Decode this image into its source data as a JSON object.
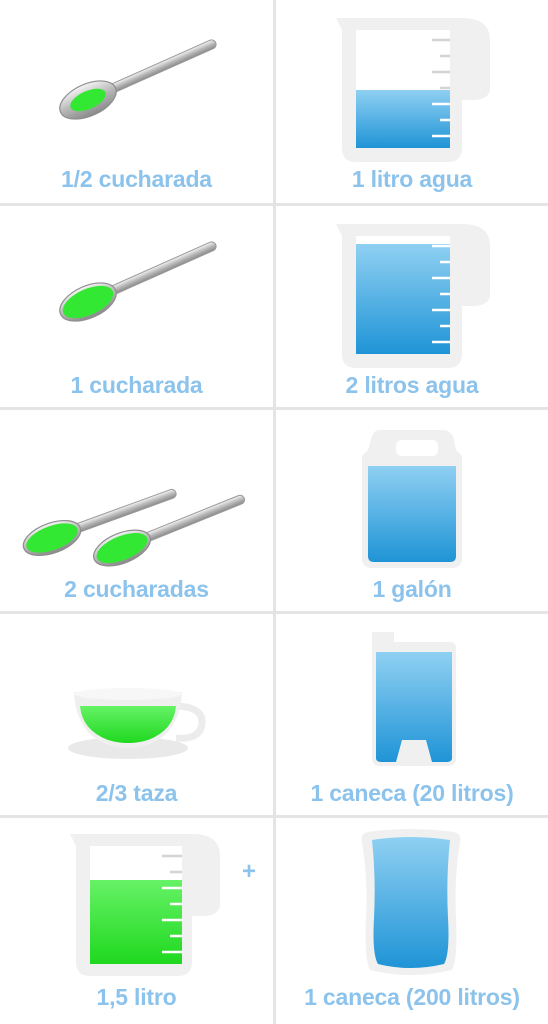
{
  "colors": {
    "label": "#8cc3ec",
    "water": "#3fa8df",
    "green": "#33e833",
    "divider": "#e4e4e4"
  },
  "rows": [
    {
      "left": {
        "label": "1/2 cucharada",
        "icon": "spoon-half-icon"
      },
      "right": {
        "label": "1 litro agua",
        "icon": "measuring-jug-icon"
      }
    },
    {
      "left": {
        "label": "1 cucharada",
        "icon": "spoon-full-icon"
      },
      "right": {
        "label": "2 litros agua",
        "icon": "measuring-jug-icon"
      }
    },
    {
      "left": {
        "label": "2 cucharadas",
        "icon": "two-spoons-icon"
      },
      "right": {
        "label": "1 galón",
        "icon": "gallon-jug-icon"
      }
    },
    {
      "left": {
        "label": "2/3 taza",
        "icon": "teacup-icon"
      },
      "right": {
        "label": "1 caneca (20 litros)",
        "icon": "jerrycan-icon"
      }
    },
    {
      "left": {
        "label": "1,5 litro",
        "icon": "measuring-jug-green-icon"
      },
      "right": {
        "label": "1 caneca (200 litros)",
        "icon": "barrel-icon"
      }
    }
  ],
  "plus_sign": "+",
  "levels": {
    "jug_1_litro": 0.5,
    "jug_2_litros": 0.85,
    "jug_1_5_litro": 0.7
  }
}
